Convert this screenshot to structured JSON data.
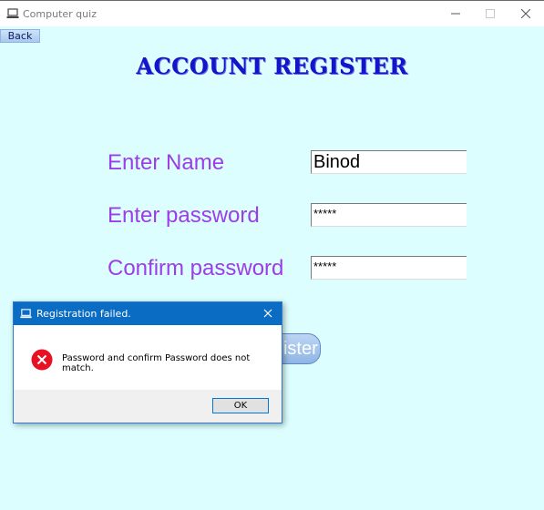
{
  "window": {
    "title": "Computer quiz",
    "app_icon": "laptop-icon",
    "background": "#dcfefe"
  },
  "toolbar": {
    "back_label": "Back"
  },
  "form": {
    "heading": "ACCOUNT REGISTER",
    "name_label": "Enter Name",
    "name_value": "Binod",
    "password_label": "Enter password",
    "password_value": "*****",
    "confirm_label": "Confirm password",
    "confirm_value": "*****",
    "register_label": "Register",
    "label_color": "#9b3ee8",
    "heading_color": "#1414c8"
  },
  "dialog": {
    "title": "Registration failed.",
    "icon": "error-icon",
    "message": "Password and confirm Password does not match.",
    "ok_label": "OK",
    "title_bar_color": "#0b6cc4",
    "error_color": "#e81123"
  }
}
